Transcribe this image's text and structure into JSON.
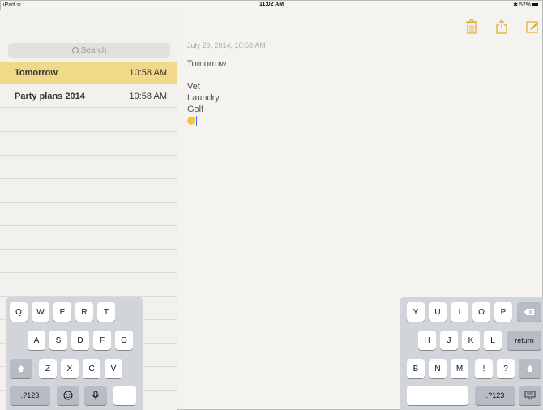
{
  "status_bar": {
    "device": "iPad ᯤ",
    "time": "11:02 AM",
    "battery": "✱ 52%"
  },
  "sidebar": {
    "search_placeholder": "Search",
    "notes": [
      {
        "title": "Tomorrow",
        "time": "10:58 AM"
      },
      {
        "title": "Party plans 2014",
        "time": "10:58 AM"
      }
    ]
  },
  "note": {
    "date": "July 29, 2014, 10:58 AM",
    "lines": [
      "Tomorrow",
      "",
      "Vet",
      "Laundry",
      "Golf"
    ]
  },
  "toolbar": {
    "icons": [
      "trash-icon",
      "share-icon",
      "compose-icon"
    ],
    "accent": "#e6a924"
  },
  "keyboard_left": {
    "row1": [
      "Q",
      "W",
      "E",
      "R",
      "T"
    ],
    "row2": [
      "A",
      "S",
      "D",
      "F",
      "G"
    ],
    "row3": [
      "Z",
      "X",
      "C",
      "V"
    ],
    "numbers": ".?123"
  },
  "keyboard_right": {
    "row1": [
      "Y",
      "U",
      "I",
      "O",
      "P"
    ],
    "row2": [
      "H",
      "J",
      "K",
      "L"
    ],
    "return": "return",
    "row3": [
      "B",
      "N",
      "M"
    ],
    "punct": [
      "!",
      "?"
    ],
    "numbers": ".?123"
  },
  "colors": {
    "selected": "#f0d988",
    "accent": "#e6a924"
  }
}
